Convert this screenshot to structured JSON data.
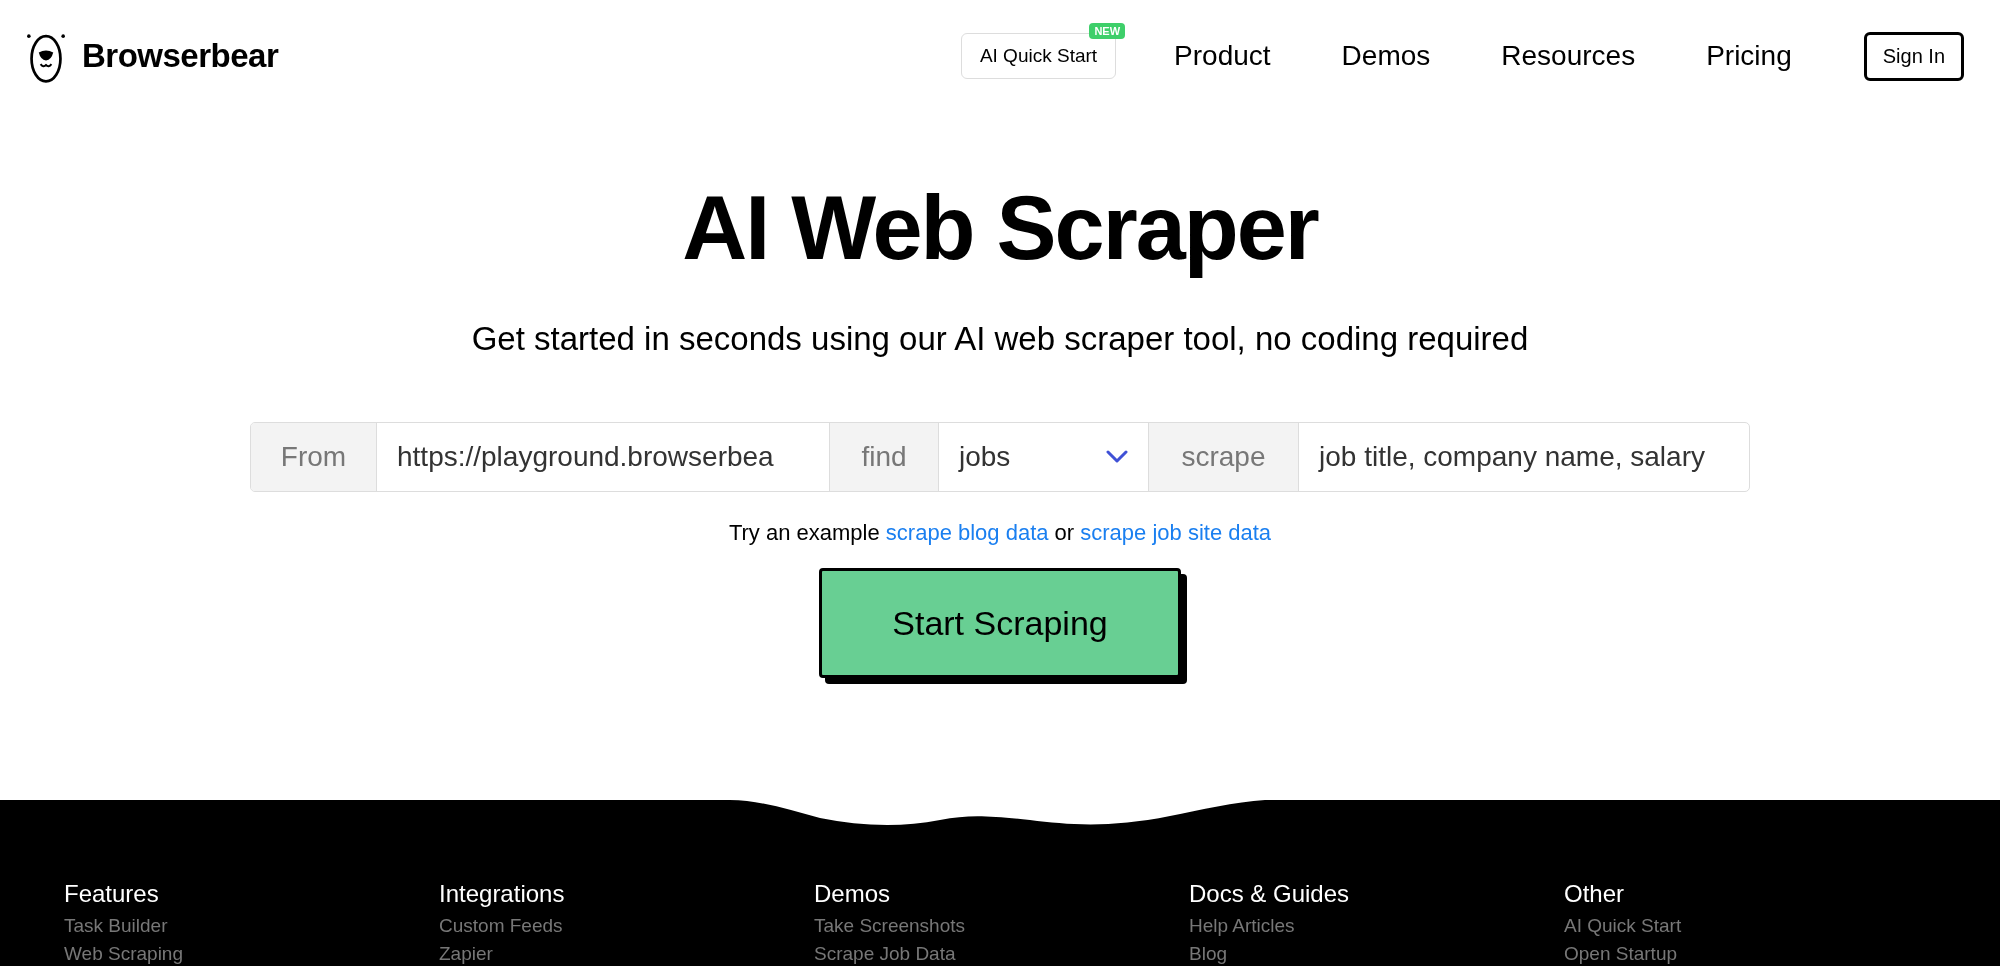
{
  "header": {
    "logo": "Browserbear",
    "quick_start": {
      "label": "AI Quick Start",
      "badge": "NEW"
    },
    "nav": [
      "Product",
      "Demos",
      "Resources",
      "Pricing"
    ],
    "sign_in": "Sign In"
  },
  "hero": {
    "title": "AI Web Scraper",
    "subtitle": "Get started in seconds using our AI web scraper tool, no coding required"
  },
  "form": {
    "segments": [
      {
        "kind": "label",
        "text": "From"
      },
      {
        "kind": "input",
        "value": "https://playground.browserbea"
      },
      {
        "kind": "label",
        "text": "find"
      },
      {
        "kind": "select",
        "value": "jobs"
      },
      {
        "kind": "label",
        "text": "scrape"
      },
      {
        "kind": "input",
        "value": "job title, company name, salary"
      }
    ],
    "example": {
      "prefix": "Try an example",
      "links": [
        "scrape blog data",
        "scrape job site data"
      ],
      "joiner": "or"
    },
    "button": "Start Scraping"
  },
  "footer": {
    "columns": [
      {
        "heading": "Features",
        "links": [
          "Task Builder",
          "Web Scraping"
        ]
      },
      {
        "heading": "Integrations",
        "links": [
          "Custom Feeds",
          "Zapier"
        ]
      },
      {
        "heading": "Demos",
        "links": [
          "Take Screenshots",
          "Scrape Job Data"
        ]
      },
      {
        "heading": "Docs & Guides",
        "links": [
          "Help Articles",
          "Blog"
        ]
      },
      {
        "heading": "Other",
        "links": [
          "AI Quick Start",
          "Open Startup"
        ]
      }
    ]
  }
}
